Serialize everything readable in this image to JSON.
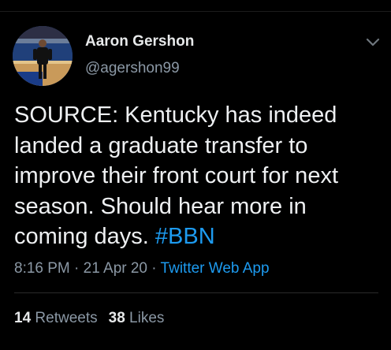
{
  "author": {
    "name": "Aaron Gershon",
    "handle": "@agershon99",
    "avatar": "profile-photo-basketball-court"
  },
  "tweet": {
    "text": "SOURCE: Kentucky has indeed landed a graduate transfer to improve their front court for next season. Should hear more in coming days.",
    "hashtag": "#BBN",
    "time": "8:16 PM",
    "date": "21 Apr 20",
    "source": "Twitter Web App",
    "separator": " · "
  },
  "stats": {
    "retweets_count": "14",
    "retweets_label": "Retweets",
    "likes_count": "38",
    "likes_label": "Likes"
  },
  "icons": {
    "menu": "chevron-down-icon"
  },
  "colors": {
    "background": "#000000",
    "link": "#1d9bf0",
    "secondary_text": "#8b98a5",
    "primary_text": "#e7e9ea"
  }
}
